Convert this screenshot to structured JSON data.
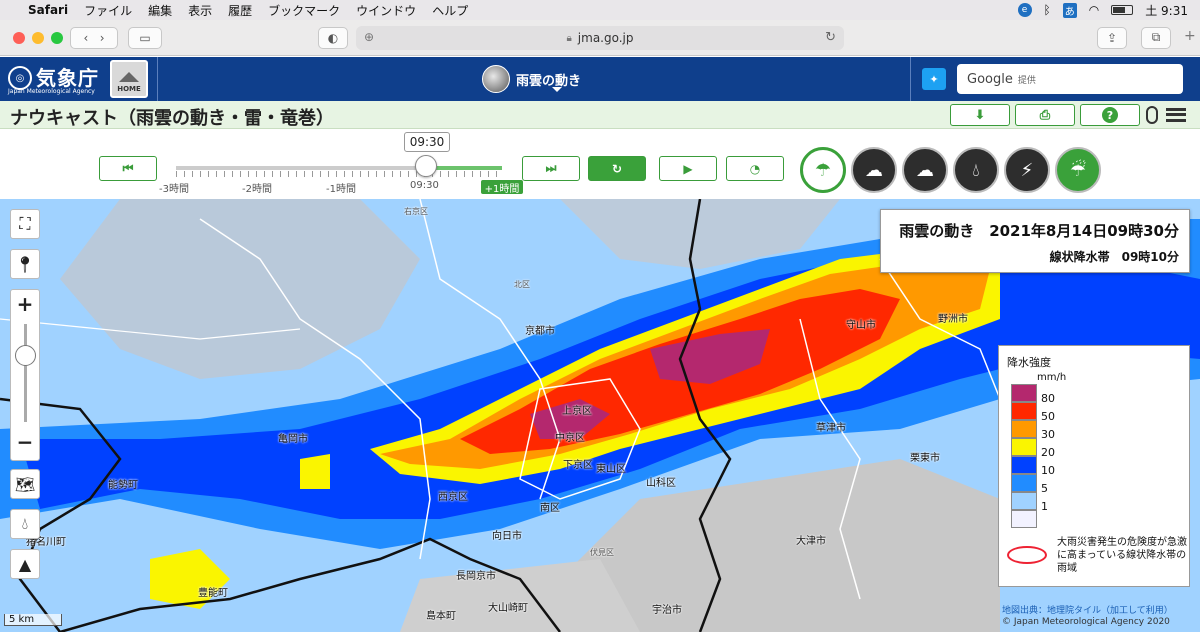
{
  "menubar": {
    "app": "Safari",
    "items": [
      "ファイル",
      "編集",
      "表示",
      "履歴",
      "ブックマーク",
      "ウインドウ",
      "ヘルプ"
    ],
    "ime": "あ",
    "clock": "土 9:31"
  },
  "browser": {
    "url": "jma.go.jp"
  },
  "header": {
    "logo_text": "気象庁",
    "logo_sub": "Japan Meteorological Agency",
    "home_label": "HOME",
    "center_title": "雨雲の動き",
    "search_brand": "Google",
    "search_provided": "提供"
  },
  "page": {
    "title": "ナウキャスト（雨雲の動き・雷・竜巻）"
  },
  "timeline": {
    "current": "09:30",
    "labels": [
      "-3時間",
      "-2時間",
      "-1時間",
      "09:30"
    ],
    "future": "+1時間"
  },
  "info": {
    "line1": "雨雲の動き　2021年8月14日09時30分",
    "line2": "線状降水帯　09時10分"
  },
  "legend": {
    "title": "降水強度",
    "unit": "mm/h",
    "levels": [
      {
        "value": "80",
        "color": "#b4286e"
      },
      {
        "value": "50",
        "color": "#ff2800"
      },
      {
        "value": "30",
        "color": "#ff9900"
      },
      {
        "value": "20",
        "color": "#faf500"
      },
      {
        "value": "10",
        "color": "#0041ff"
      },
      {
        "value": "5",
        "color": "#218cff"
      },
      {
        "value": "1",
        "color": "#a0d2ff"
      },
      {
        "value": "",
        "color": "#f2f2ff"
      }
    ],
    "band_desc": "大雨災害発生の危険度が急激に高まっている線状降水帯の雨域"
  },
  "map": {
    "places": [
      "右京区",
      "北区",
      "京都市",
      "上京区",
      "中京区",
      "下京区",
      "東山区",
      "山科区",
      "南区",
      "西京区",
      "向日市",
      "伏見区",
      "長岡京市",
      "大山崎町",
      "島本町",
      "宇治市",
      "亀岡市",
      "能勢町",
      "豊能町",
      "猪名川町",
      "大津市",
      "草津市",
      "栗東市",
      "守山市",
      "野洲市"
    ],
    "scale": "5 km"
  },
  "credits": {
    "source": "地図出典：地理院タイル（加工して利用）",
    "copyright": "© Japan Meteorological Agency 2020"
  }
}
